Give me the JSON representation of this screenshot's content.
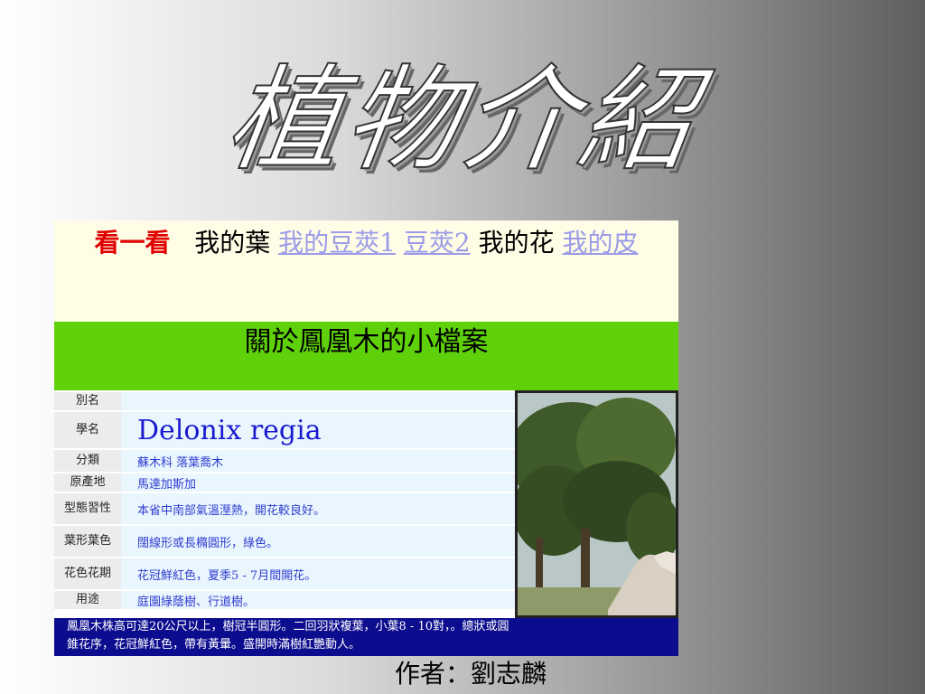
{
  "title": "植物介紹",
  "nav": {
    "lead": "看一看",
    "item1": "我的葉",
    "link1": "我的豆莢1",
    "link2": "豆莢2",
    "item2": "我的花",
    "link3": "我的皮"
  },
  "banner": "關於鳳凰木的小檔案",
  "rows": [
    {
      "label": "別名",
      "value": ""
    },
    {
      "label": "學名",
      "value": "Delonix regia"
    },
    {
      "label": "分類",
      "value": "蘇木科 落葉喬木"
    },
    {
      "label": "原產地",
      "value": "馬達加斯加"
    },
    {
      "label": "型態習性",
      "value": "本省中南部氣溫溼熱，開花較良好。"
    },
    {
      "label": "葉形葉色",
      "value": "闊線形或長橢圓形，綠色。"
    },
    {
      "label": "花色花期",
      "value": "花冠鮮紅色，夏季5 - 7月間開花。"
    },
    {
      "label": "用途",
      "value": "庭園綠蔭樹、行道樹。"
    }
  ],
  "footer": {
    "line1": "鳳凰木株高可達20公尺以上，樹冠半圓形。二回羽狀複葉，小葉8 - 10對，。總狀或圓",
    "line2": "錐花序，花冠鮮紅色，帶有黃暈。盛開時滿樹紅艷動人。"
  },
  "author": "作者：劉志麟",
  "colors": {
    "nav_bg": "#fffde6",
    "banner_bg": "#5fd10a",
    "footer_bg": "#0c0c8e",
    "link": "#9b9be8",
    "lead": "#e00000",
    "value_text": "#2e3cd0"
  }
}
